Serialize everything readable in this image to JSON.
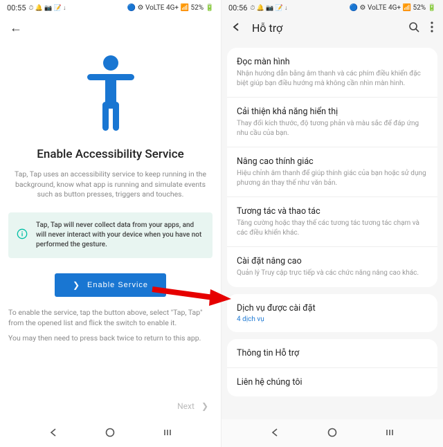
{
  "left": {
    "status": {
      "time": "00:55",
      "small_icons": "⏱ 🔔 📷 📝 ↓",
      "right": "🔵 ⚙ VoLTE 4G+ 📶 52% 🔋"
    },
    "title": "Enable Accessibility Service",
    "desc": "Tap, Tap uses an accessibility service to keep running in the background, know what app is running and simulate events such as button presses, triggers and touches.",
    "info_text": "Tap, Tap will never collect data from your apps, and will never interact with your device when you have not performed the gesture.",
    "enable_label": "Enable Service",
    "instr1": "To enable the service, tap the button above, select \"Tap, Tap\" from the opened list and flick the switch to enable it.",
    "instr2": "You may then need to press back twice to return to this app.",
    "next": "Next"
  },
  "right": {
    "status": {
      "time": "00:56",
      "small_icons": "⏱ 🔔 📷 📝 ↓",
      "right": "🔵 ⚙ VoLTE 4G+ 📶 52% 🔋"
    },
    "header_title": "Hỗ trợ",
    "items": [
      {
        "title": "Đọc màn hình",
        "desc": "Nhận hướng dẫn bằng âm thanh và các phím điều khiển đặc biệt giúp bạn điều hướng mà không cần nhìn màn hình."
      },
      {
        "title": "Cải thiện khả năng hiển thị",
        "desc": "Thay đổi kích thước, độ tương phản và màu sắc để đáp ứng nhu cầu của bạn."
      },
      {
        "title": "Nâng cao thính giác",
        "desc": "Hiệu chỉnh âm thanh để giúp thính giác của bạn hoặc sử dụng phương án thay thế như văn bản."
      },
      {
        "title": "Tương tác và thao tác",
        "desc": "Tăng cường hoặc thay thế các tương tác tương tác chạm và các điều khiển khác."
      },
      {
        "title": "Cài đặt nâng cao",
        "desc": "Quản lý Truy cập trực tiếp và các chức năng nâng cao khác."
      },
      {
        "title": "Dịch vụ được cài đặt",
        "link": "4 dịch vụ"
      },
      {
        "title": "Thông tin Hỗ trợ"
      },
      {
        "title": "Liên hệ chúng tôi"
      }
    ]
  }
}
